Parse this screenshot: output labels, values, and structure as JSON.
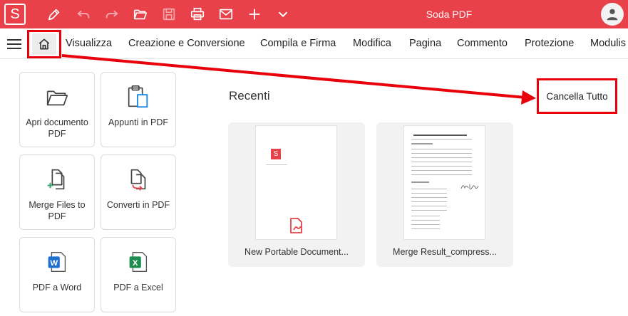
{
  "titlebar": {
    "logo_letter": "S",
    "app_title": "Soda PDF",
    "icons": [
      "pen-icon",
      "undo-icon",
      "redo-icon",
      "open-folder-icon",
      "save-icon",
      "print-icon",
      "mail-icon",
      "plus-icon",
      "chevron-down-icon"
    ],
    "accent": "#e8414a"
  },
  "menubar": {
    "items": [
      "Visualizza",
      "Creazione e Conversione",
      "Compila e Firma",
      "Modifica",
      "Pagina",
      "Commento",
      "Protezione",
      "Modulis"
    ]
  },
  "tiles": [
    {
      "label": "Apri documento PDF",
      "icon": "open-folder-icon"
    },
    {
      "label": "Appunti in PDF",
      "icon": "clipboard-icon"
    },
    {
      "label": "Merge Files to PDF",
      "icon": "merge-files-icon"
    },
    {
      "label": "Converti in PDF",
      "icon": "convert-icon"
    },
    {
      "label": "PDF a Word",
      "icon": "word-icon",
      "glyph": "W"
    },
    {
      "label": "PDF a Excel",
      "icon": "excel-icon",
      "glyph": "X"
    }
  ],
  "recent": {
    "title": "Recenti",
    "clear_label": "Cancella Tutto",
    "files": [
      {
        "name": "New Portable Document..."
      },
      {
        "name": "Merge Result_compress..."
      }
    ]
  },
  "annotation_color": "#e8000b"
}
